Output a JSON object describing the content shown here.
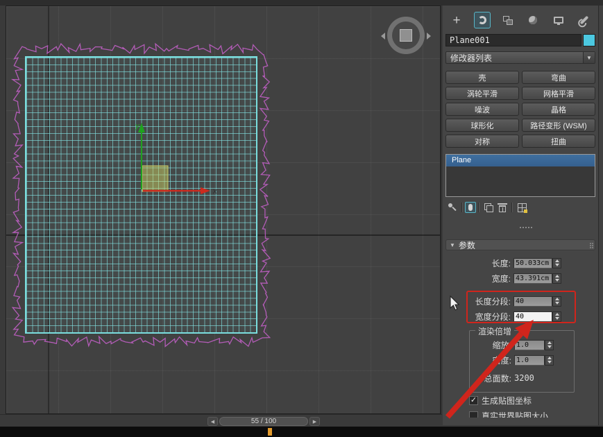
{
  "viewport": {
    "axis_x": "x",
    "axis_y": "y"
  },
  "timeline": {
    "frame_display": "55 / 100"
  },
  "icons": {
    "plus": "+",
    "dropdown_arrow": "▼",
    "rollout_arrow": "▼",
    "check": "✓",
    "prev_frame": "◀",
    "next_frame": "▶"
  },
  "panel": {
    "object_name": "Plane001",
    "modifier_list_label": "修改器列表",
    "modifier_buttons": [
      {
        "label": "壳"
      },
      {
        "label": "弯曲"
      },
      {
        "label": "涡轮平滑"
      },
      {
        "label": "网格平滑"
      },
      {
        "label": "噪波"
      },
      {
        "label": "晶格"
      },
      {
        "label": "球形化"
      },
      {
        "label": "路径变形 (WSM)"
      },
      {
        "label": "对称"
      },
      {
        "label": "扭曲"
      }
    ],
    "stack_items": [
      {
        "label": "Plane",
        "selected": true
      }
    ],
    "rollout_title": "参数",
    "params": {
      "length_label": "长度:",
      "length_value": "50.033cm",
      "width_label": "宽度:",
      "width_value": "43.391cm",
      "length_segs_label": "长度分段:",
      "length_segs_value": "40",
      "width_segs_label": "宽度分段:",
      "width_segs_value": "40"
    },
    "render_scale_group": {
      "title": "渲染倍增",
      "scale_label": "缩放:",
      "scale_value": "1.0",
      "density_label": "密度:",
      "density_value": "1.0",
      "total_faces_label": "总面数:",
      "total_faces_value": "3200"
    },
    "checkbox_generate_uv": {
      "label": "生成贴图坐标",
      "checked": true
    },
    "checkbox_realworld": {
      "label": "真实世界贴图大小",
      "checked": false
    }
  },
  "colors": {
    "object_color_swatch": "#4cc8e0",
    "selected_stack_item": "#3f6f9f",
    "annotation_red": "#d0251c",
    "plane_wire_cyan": "#7adede",
    "plane_outline_magenta": "#c05fc4",
    "axis_x_red": "#cc2a1e",
    "axis_y_green": "#1fa11f",
    "active_tab_teal": "#58b7c9"
  }
}
